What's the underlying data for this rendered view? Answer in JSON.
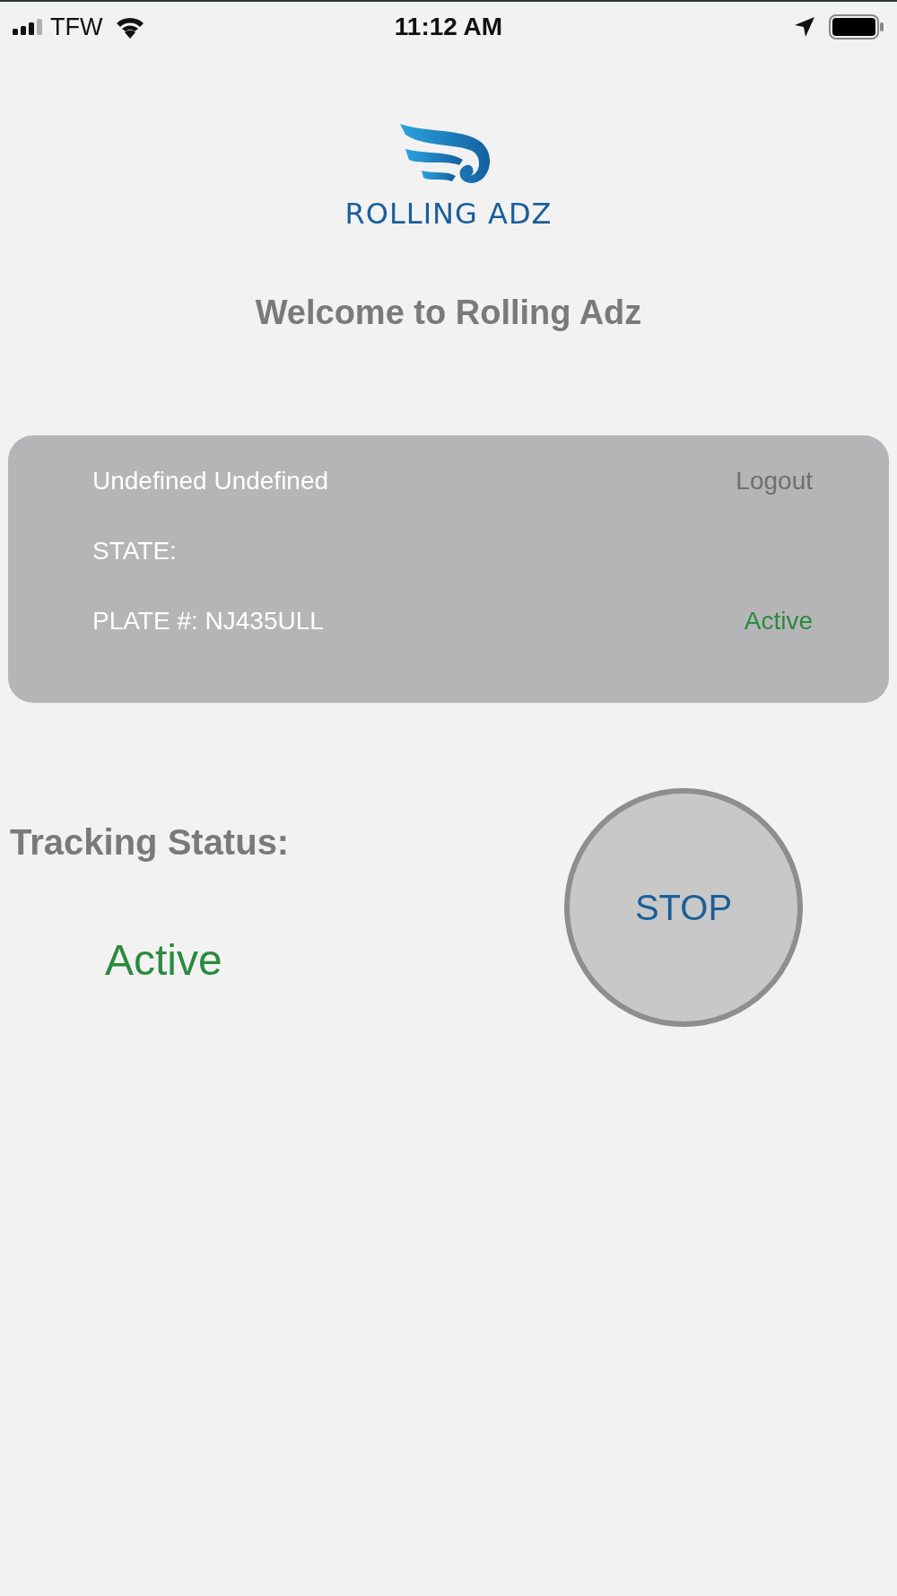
{
  "status_bar": {
    "carrier": "TFW",
    "time": "11:12 AM"
  },
  "logo": {
    "text": "ROLLING ADZ"
  },
  "welcome": "Welcome to Rolling Adz",
  "account": {
    "name": "Undefined Undefined",
    "logout": "Logout",
    "state_label": "STATE:",
    "plate": "PLATE #: NJ435ULL",
    "status": {
      "text": "Active",
      "active": true
    }
  },
  "tracking": {
    "label": "Tracking Status:",
    "status": {
      "text": "Active",
      "active": true
    },
    "button": "STOP"
  }
}
